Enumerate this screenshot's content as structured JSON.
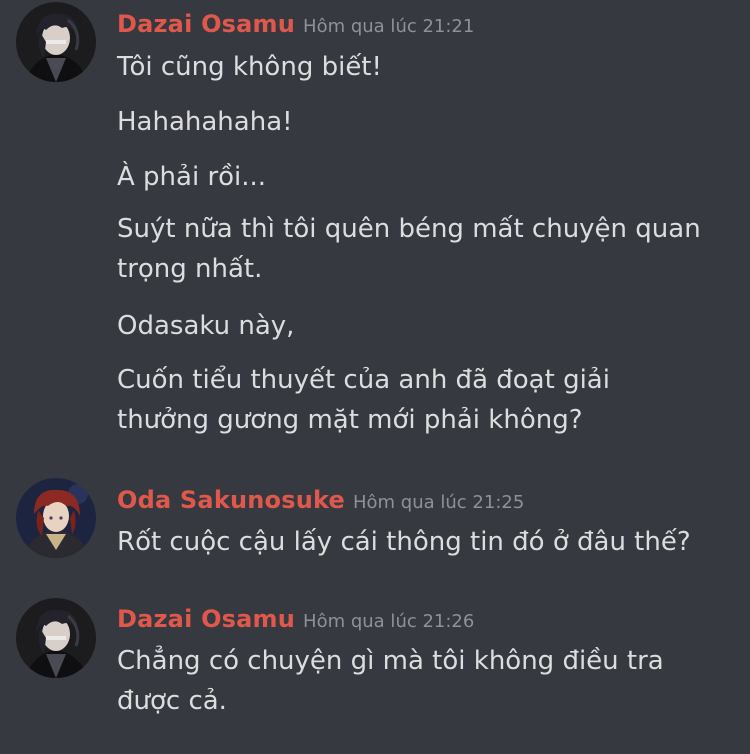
{
  "groups": [
    {
      "author": "Dazai Osamu",
      "time": "Hôm qua lúc 21:21",
      "messages": [
        "Tôi cũng không biết!",
        "Hahahahaha!",
        "À phải rồi...",
        "Suýt nữa thì tôi quên béng mất chuyện quan trọng nhất.",
        "Odasaku này,",
        "Cuốn tiểu thuyết của anh đã đoạt giải thưởng gương mặt mới phải không?"
      ]
    },
    {
      "author": "Oda Sakunosuke",
      "time": "Hôm qua lúc 21:25",
      "messages": [
        "Rốt cuộc cậu lấy cái thông tin đó ở đâu thế?"
      ]
    },
    {
      "author": "Dazai Osamu",
      "time": "Hôm qua lúc 21:26",
      "messages": [
        "Chẳng có chuyện gì mà tôi không điều tra được cả."
      ]
    }
  ],
  "colors": {
    "background": "#36393f",
    "author": "#e0584c",
    "timestamp": "#8e9297",
    "message_text": "#dcddde"
  },
  "icons": {
    "dazai_avatar": "dazai-avatar-icon",
    "oda_avatar": "oda-avatar-icon"
  }
}
